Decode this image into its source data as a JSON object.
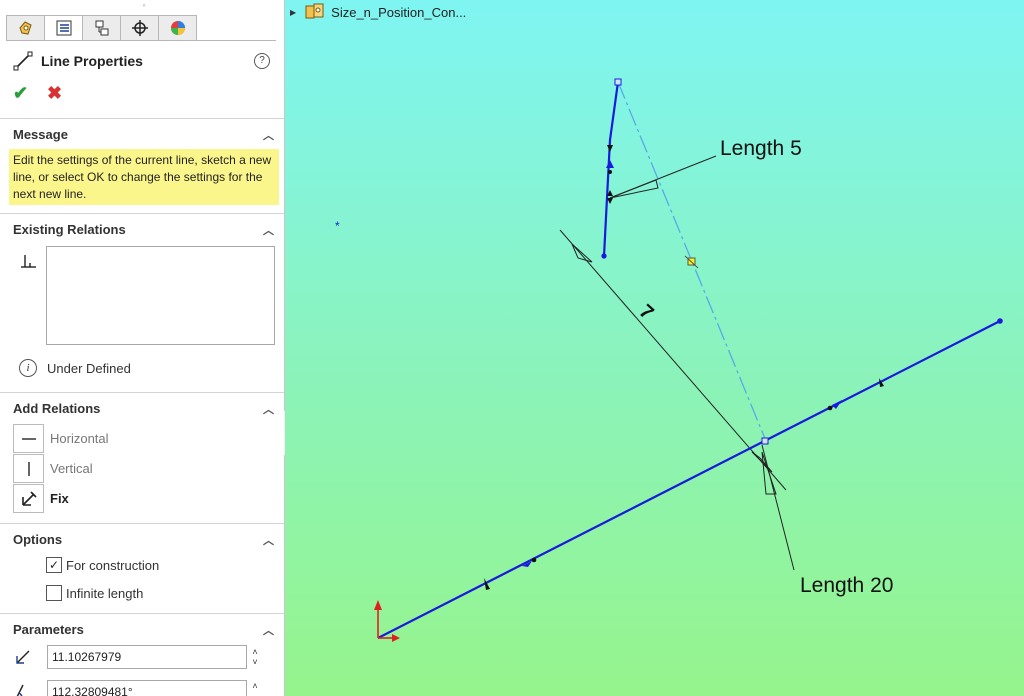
{
  "panel": {
    "tabs": [
      {
        "icon": "feature-manager-icon"
      },
      {
        "icon": "property-manager-icon"
      },
      {
        "icon": "configuration-manager-icon"
      },
      {
        "icon": "dimxpert-icon"
      },
      {
        "icon": "display-manager-icon"
      }
    ],
    "title": "Line Properties",
    "help_symbol": "?",
    "ok_symbol": "✔",
    "cancel_symbol": "✖",
    "message": {
      "header": "Message",
      "text": "Edit the settings of the current line, sketch a new line, or select OK to change the settings for the next new line."
    },
    "existing_relations": {
      "header": "Existing Relations",
      "status": "Under Defined"
    },
    "add_relations": {
      "header": "Add Relations",
      "items": [
        {
          "label": "Horizontal",
          "enabled": false
        },
        {
          "label": "Vertical",
          "enabled": false
        },
        {
          "label": "Fix",
          "enabled": true
        }
      ]
    },
    "options": {
      "header": "Options",
      "for_construction": {
        "label": "For construction",
        "checked": true,
        "mark": "✓"
      },
      "infinite_length": {
        "label": "Infinite length",
        "checked": false
      }
    },
    "parameters": {
      "header": "Parameters",
      "length": "11.10267979",
      "angle": "112.32809481°"
    }
  },
  "tree": {
    "label": "Size_n_Position_Con..."
  },
  "graphics": {
    "callouts": {
      "length5": "Length 5",
      "length20": "Length 20",
      "dim7": "7"
    },
    "colors": {
      "sketch_line": "#1a1adb",
      "construction_line": "#5aa8e8",
      "annotation": "#111111",
      "bg_top": "#7ff5f3",
      "bg_bottom": "#96f48c"
    }
  }
}
